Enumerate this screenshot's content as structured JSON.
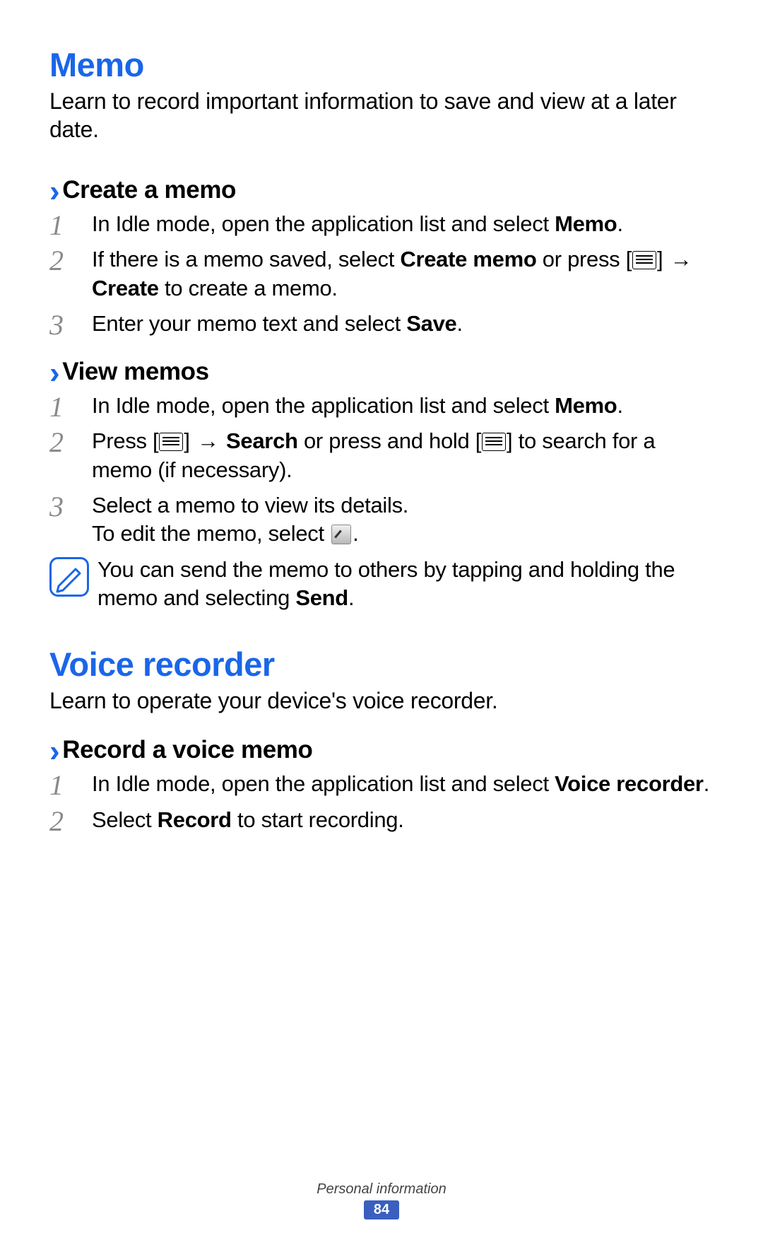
{
  "section1": {
    "title": "Memo",
    "intro": "Learn to record important information to save and view at a later date.",
    "sub1": {
      "title": "Create a memo",
      "steps": {
        "1": {
          "pre": "In Idle mode, open the application list and select ",
          "bold": "Memo",
          "post": "."
        },
        "2": {
          "pre": "If there is a memo saved, select ",
          "bold1": "Create memo",
          "mid": " or press [",
          "arrow": "→",
          "bold2": "Create",
          "post": " to create a memo."
        },
        "3": {
          "pre": "Enter your memo text and select ",
          "bold": "Save",
          "post": "."
        }
      }
    },
    "sub2": {
      "title": "View memos",
      "steps": {
        "1": {
          "pre": "In Idle mode, open the application list and select ",
          "bold": "Memo",
          "post": "."
        },
        "2": {
          "pre": "Press [",
          "arrow": "→",
          "bold": "Search",
          "mid": " or press and hold [",
          "post": "] to search for a memo (if necessary)."
        },
        "3": {
          "line1": "Select a memo to view its details.",
          "line2_pre": "To edit the memo, select ",
          "line2_post": "."
        }
      },
      "note": {
        "pre": "You can send the memo to others by tapping and holding the memo and selecting ",
        "bold": "Send",
        "post": "."
      }
    }
  },
  "section2": {
    "title": "Voice recorder",
    "intro": "Learn to operate your device's voice recorder.",
    "sub1": {
      "title": "Record a voice memo",
      "steps": {
        "1": {
          "pre": "In Idle mode, open the application list and select ",
          "bold": "Voice recorder",
          "post": "."
        },
        "2": {
          "pre": "Select ",
          "bold": "Record",
          "post": " to start recording."
        }
      }
    }
  },
  "footer": {
    "chapter": "Personal information",
    "page": "84"
  },
  "nums": {
    "n1": "1",
    "n2": "2",
    "n3": "3"
  }
}
